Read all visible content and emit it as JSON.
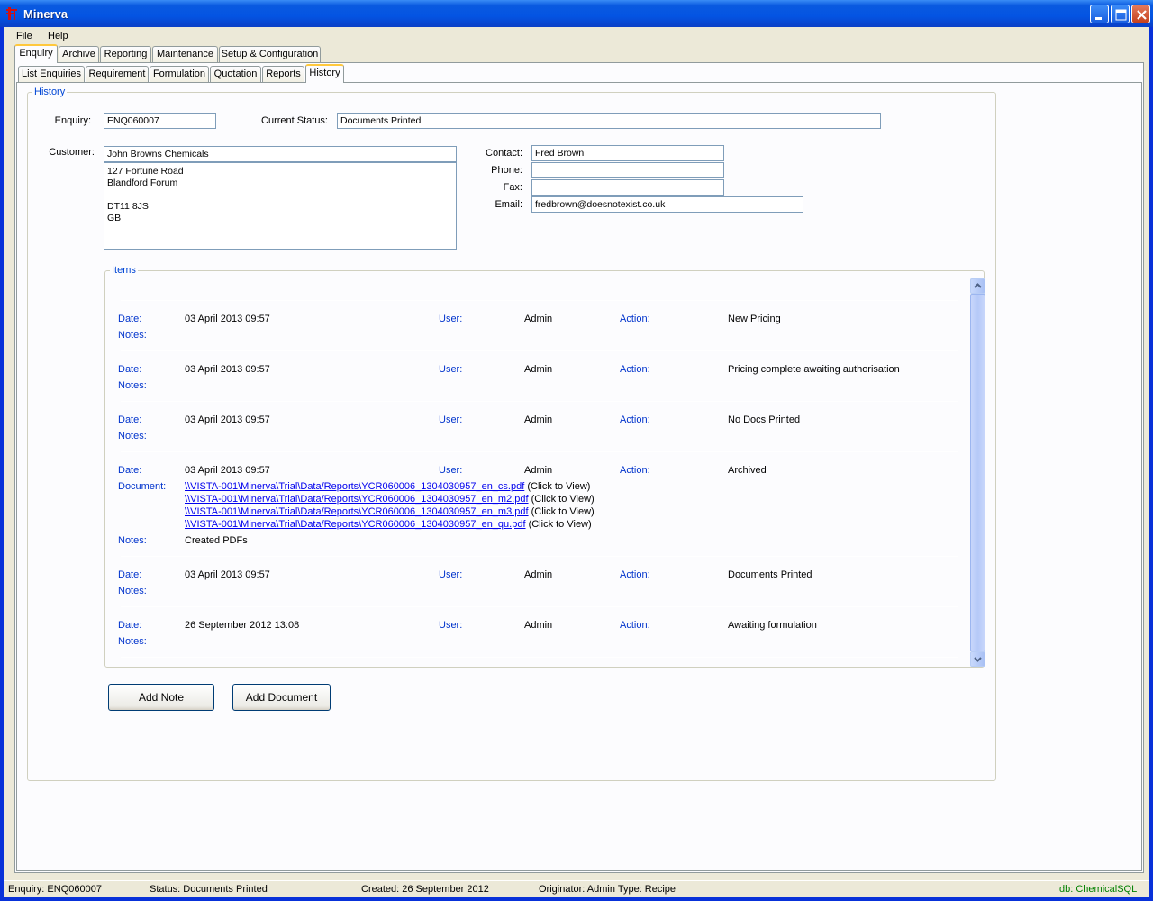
{
  "window": {
    "title": "Minerva"
  },
  "menu": {
    "items": [
      "File",
      "Help"
    ]
  },
  "main_tabs": [
    "Enquiry",
    "Archive",
    "Reporting",
    "Maintenance",
    "Setup & Configuration"
  ],
  "sub_tabs": [
    "List Enquiries",
    "Requirement",
    "Formulation",
    "Quotation",
    "Reports",
    "History"
  ],
  "history": {
    "group_label": "History",
    "enquiry_label": "Enquiry:",
    "enquiry_value": "ENQ060007",
    "status_label": "Current Status:",
    "status_value": "Documents Printed",
    "customer_label": "Customer:",
    "customer_name": "John Browns Chemicals",
    "customer_address": "127 Fortune Road\nBlandford Forum\n\nDT11 8JS\nGB",
    "contact_label": "Contact:",
    "contact_value": "Fred Brown",
    "phone_label": "Phone:",
    "phone_value": "",
    "fax_label": "Fax:",
    "fax_value": "",
    "email_label": "Email:",
    "email_value": "fredbrown@doesnotexist.co.uk"
  },
  "items": {
    "group_label": "Items",
    "labels": {
      "date": "Date:",
      "user": "User:",
      "action": "Action:",
      "notes": "Notes:",
      "document": "Document:"
    },
    "entries": [
      {
        "date": "03 April 2013 09:57",
        "user": "Admin",
        "action": "New Pricing",
        "notes": ""
      },
      {
        "date": "03 April 2013 09:57",
        "user": "Admin",
        "action": "Pricing complete awaiting authorisation",
        "notes": ""
      },
      {
        "date": "03 April 2013 09:57",
        "user": "Admin",
        "action": "No Docs Printed",
        "notes": ""
      },
      {
        "date": "03 April 2013 09:57",
        "user": "Admin",
        "action": "Archived",
        "notes": "Created PDFs",
        "documents": [
          "\\\\VISTA-001\\Minerva\\Trial\\Data/Reports\\YCR060006_1304030957_en_cs.pdf",
          "\\\\VISTA-001\\Minerva\\Trial\\Data/Reports\\YCR060006_1304030957_en_m2.pdf",
          "\\\\VISTA-001\\Minerva\\Trial\\Data/Reports\\YCR060006_1304030957_en_m3.pdf",
          "\\\\VISTA-001\\Minerva\\Trial\\Data/Reports\\YCR060006_1304030957_en_qu.pdf"
        ],
        "click_hint": "(Click to View)"
      },
      {
        "date": "03 April 2013 09:57",
        "user": "Admin",
        "action": "Documents Printed",
        "notes": ""
      },
      {
        "date": "26 September 2012 13:08",
        "user": "Admin",
        "action": "Awaiting formulation",
        "notes": ""
      }
    ]
  },
  "buttons": {
    "add_note": "Add Note",
    "add_document": "Add Document"
  },
  "statusbar": {
    "enquiry": "Enquiry: ENQ060007",
    "status": "Status: Documents Printed",
    "created": "Created: 26 September 2012",
    "originator": "Originator: Admin  Type: Recipe",
    "db": "db: ChemicalSQL"
  },
  "colors": {
    "db_text": "#008000",
    "label_blue": "#0033cc",
    "link": "#0000ee"
  }
}
